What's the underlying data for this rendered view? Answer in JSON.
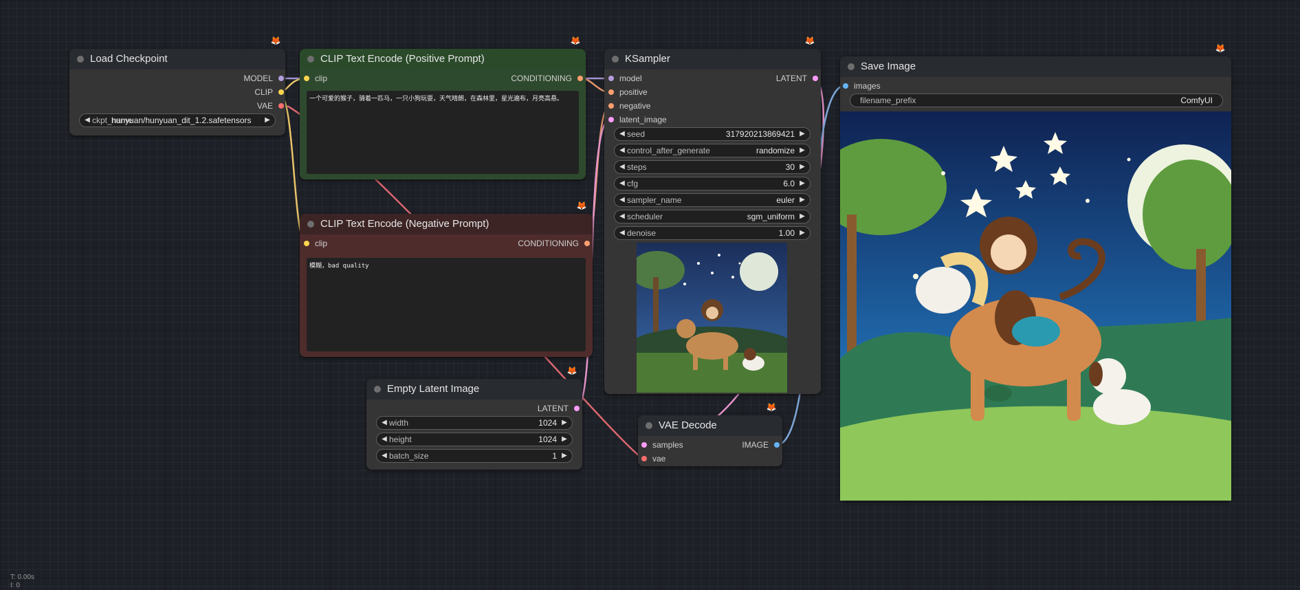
{
  "nodes": {
    "load_checkpoint": {
      "title": "Load Checkpoint",
      "outputs": [
        "MODEL",
        "CLIP",
        "VAE"
      ],
      "ckpt_name": {
        "name": "ckpt_name",
        "value": "hunyuan/hunyuan_dit_1.2.safetensors"
      }
    },
    "clip_positive": {
      "title": "CLIP Text Encode (Positive Prompt)",
      "input": "clip",
      "output": "CONDITIONING",
      "text": "一个可爱的猴子，骑着一匹马，一只小狗玩耍，天气晴朗，在森林里，星光遍布，月亮高悬。",
      "color": "#2a4a2a"
    },
    "clip_negative": {
      "title": "CLIP Text Encode (Negative Prompt)",
      "input": "clip",
      "output": "CONDITIONING",
      "text": "模糊，bad quality",
      "color": "#4a2a2a"
    },
    "ksampler": {
      "title": "KSampler",
      "inputs": [
        "model",
        "positive",
        "negative",
        "latent_image"
      ],
      "output": "LATENT",
      "widgets": [
        {
          "name": "seed",
          "value": "317920213869421"
        },
        {
          "name": "control_after_generate",
          "value": "randomize"
        },
        {
          "name": "steps",
          "value": "30"
        },
        {
          "name": "cfg",
          "value": "6.0"
        },
        {
          "name": "sampler_name",
          "value": "euler"
        },
        {
          "name": "scheduler",
          "value": "sgm_uniform"
        },
        {
          "name": "denoise",
          "value": "1.00"
        }
      ]
    },
    "empty_latent": {
      "title": "Empty Latent Image",
      "output": "LATENT",
      "widgets": [
        {
          "name": "width",
          "value": "1024"
        },
        {
          "name": "height",
          "value": "1024"
        },
        {
          "name": "batch_size",
          "value": "1"
        }
      ]
    },
    "vae_decode": {
      "title": "VAE Decode",
      "inputs": [
        "samples",
        "vae"
      ],
      "output": "IMAGE"
    },
    "save_image": {
      "title": "Save Image",
      "input": "images",
      "filename_prefix": {
        "name": "filename_prefix",
        "value": "ComfyUI"
      }
    }
  },
  "status": {
    "time": "T: 0.00s",
    "iterations": "I: 0"
  },
  "colors": {
    "model_slot": "#b39ddb",
    "clip_slot": "#ffd54f",
    "vae_slot": "#ff6e6e",
    "conditioning_slot": "#ffa070",
    "latent_slot": "#ff9cf9",
    "image_slot": "#64b5f6"
  }
}
